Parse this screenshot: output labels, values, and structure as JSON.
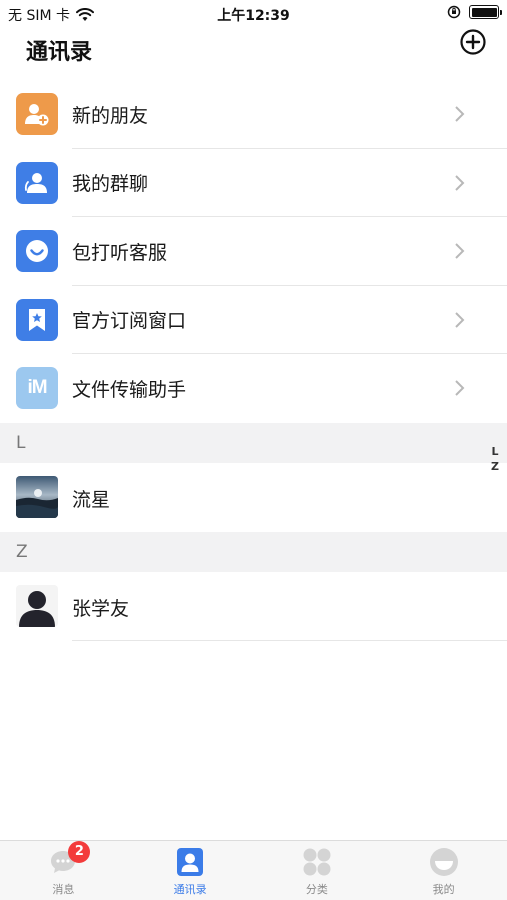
{
  "status_bar": {
    "carrier": "无 SIM 卡",
    "time": "上午12:39"
  },
  "header": {
    "title": "通讯录"
  },
  "menu_items": [
    {
      "label": "新的朋友",
      "icon": "new-friends-icon",
      "color": "#ee9a4a"
    },
    {
      "label": "我的群聊",
      "icon": "group-chat-icon",
      "color": "#3f7ee6"
    },
    {
      "label": "包打听客服",
      "icon": "customer-service-icon",
      "color": "#3f7ee6"
    },
    {
      "label": "官方订阅窗口",
      "icon": "subscription-icon",
      "color": "#3f7ee6"
    },
    {
      "label": "文件传输助手",
      "icon": "file-transfer-icon",
      "color": "#9cc8ef"
    }
  ],
  "file_transfer_icon_text": "iM",
  "sections": [
    {
      "letter": "L",
      "contacts": [
        {
          "name": "流星"
        }
      ]
    },
    {
      "letter": "Z",
      "contacts": [
        {
          "name": "张学友"
        }
      ]
    }
  ],
  "index_bar": [
    "L",
    "Z"
  ],
  "tabs": [
    {
      "label": "消息",
      "badge": "2",
      "icon": "message-icon"
    },
    {
      "label": "通讯录",
      "icon": "contacts-icon",
      "active": true
    },
    {
      "label": "分类",
      "icon": "category-icon"
    },
    {
      "label": "我的",
      "icon": "profile-icon"
    }
  ],
  "colors": {
    "accent": "#3b7ce8",
    "badge": "#f33b3b",
    "section_bg": "#f2f2f3"
  }
}
